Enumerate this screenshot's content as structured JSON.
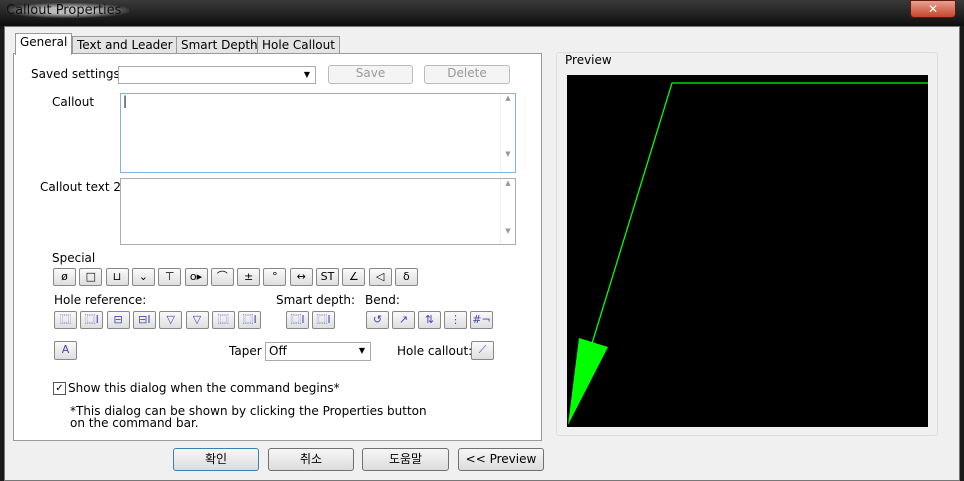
{
  "window": {
    "title": "Callout Properties",
    "close": "✕"
  },
  "tabs": [
    "General",
    "Text and Leader",
    "Smart Depth",
    "Hole Callout"
  ],
  "general": {
    "saved_settings_label": "Saved settings:",
    "saved_settings_value": "",
    "save": "Save",
    "delete": "Delete",
    "callout_label": "Callout",
    "callout_value": "|",
    "callout2_label": "Callout text 2:",
    "callout2_value": "",
    "special_label": "Special",
    "special_icons": [
      "ø",
      "□",
      "⊔",
      "⌄",
      "⊤",
      "o▸",
      "⌒",
      "±",
      "°",
      "↔",
      "ST",
      "∠",
      "◁",
      "δ"
    ],
    "hole_ref_label": "Hole reference:",
    "hole_ref_icons": [
      "⿴",
      "⿴I",
      "⊟",
      "⊟I",
      "▽",
      "▽",
      "⿴",
      "⿴I"
    ],
    "smart_depth_label": "Smart depth:",
    "smart_depth_icons": [
      "⿴I",
      "⿴I"
    ],
    "bend_label": "Bend:",
    "bend_icons": [
      "↺",
      "↗",
      "⇅",
      "⋮",
      "#¬"
    ],
    "text_icon": "A",
    "taper_label": "Taper",
    "taper_value": "Off",
    "hole_callout_label": "Hole callout:",
    "hole_callout_icon": "⟋",
    "show_dialog_label": "Show this dialog when the command begins*",
    "show_dialog_checked": true,
    "note_line1": "*This dialog can be shown by clicking the Properties button",
    "note_line2": "on the command bar."
  },
  "preview": {
    "label": "Preview",
    "line_color": "#00ff00"
  },
  "buttons": {
    "ok": "확인",
    "cancel": "취소",
    "help": "도움말",
    "preview": "<< Preview"
  }
}
